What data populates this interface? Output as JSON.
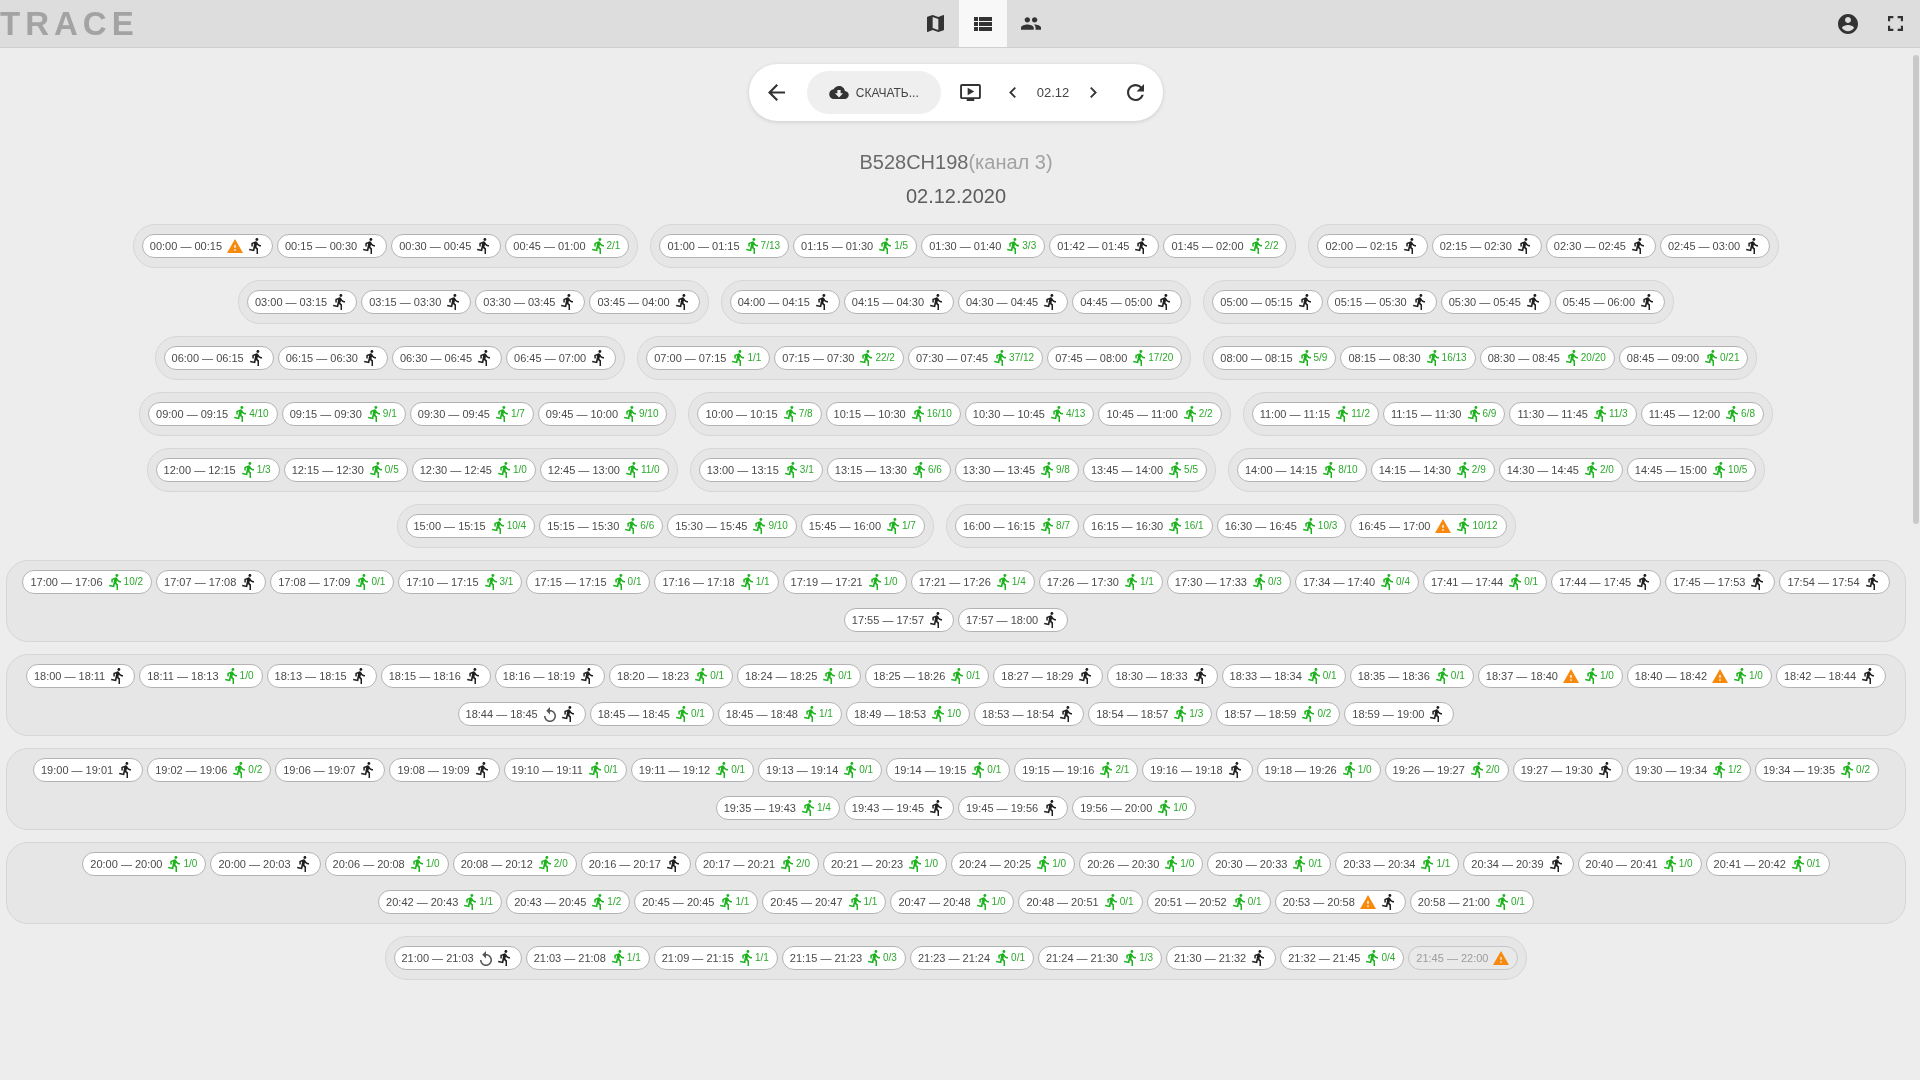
{
  "top_bar": {
    "logo": "TRACE",
    "nav_tabs": [
      {
        "selected": false
      },
      {
        "selected": true
      },
      {
        "selected": false
      }
    ]
  },
  "toolbar": {
    "download_label": "СКАЧАТЬ...",
    "date": "02.12"
  },
  "heading": {
    "camera": "B528CH198",
    "channel": "(канал 3)",
    "date": "02.12.2020"
  },
  "hour_groups": [
    {
      "lines": [
        {
          "chips": [
            {
              "time": "00:00 — 00:15",
              "kind": "idle",
              "alert": true,
              "replayed": false
            },
            {
              "time": "00:15 — 00:30",
              "kind": "idle",
              "alert": false,
              "replayed": false
            },
            {
              "time": "00:30 — 00:45",
              "kind": "idle",
              "alert": false,
              "replayed": false
            },
            {
              "time": "00:45 — 01:00",
              "kind": "counted",
              "count": "2/1",
              "alert": false,
              "replayed": false
            }
          ]
        }
      ]
    },
    {
      "lines": [
        {
          "chips": [
            {
              "time": "01:00 — 01:15",
              "kind": "counted",
              "count": "7/13",
              "alert": false,
              "replayed": false
            },
            {
              "time": "01:15 — 01:30",
              "kind": "counted",
              "count": "1/5",
              "alert": false,
              "replayed": false
            },
            {
              "time": "01:30 — 01:40",
              "kind": "counted",
              "count": "3/3",
              "alert": false,
              "replayed": false
            },
            {
              "time": "01:42 — 01:45",
              "kind": "idle",
              "alert": false,
              "replayed": false
            },
            {
              "time": "01:45 — 02:00",
              "kind": "counted",
              "count": "2/2",
              "alert": false,
              "replayed": false
            }
          ]
        }
      ]
    },
    {
      "lines": [
        {
          "chips": [
            {
              "time": "02:00 — 02:15",
              "kind": "idle",
              "alert": false,
              "replayed": false
            },
            {
              "time": "02:15 — 02:30",
              "kind": "idle",
              "alert": false,
              "replayed": false
            },
            {
              "time": "02:30 — 02:45",
              "kind": "idle",
              "alert": false,
              "replayed": false
            },
            {
              "time": "02:45 — 03:00",
              "kind": "idle",
              "alert": false,
              "replayed": false
            }
          ]
        }
      ]
    },
    {
      "lines": [
        {
          "chips": [
            {
              "time": "03:00 — 03:15",
              "kind": "idle",
              "alert": false,
              "replayed": false
            },
            {
              "time": "03:15 — 03:30",
              "kind": "idle",
              "alert": false,
              "replayed": false
            },
            {
              "time": "03:30 — 03:45",
              "kind": "idle",
              "alert": false,
              "replayed": false
            },
            {
              "time": "03:45 — 04:00",
              "kind": "idle",
              "alert": false,
              "replayed": false
            }
          ]
        }
      ]
    },
    {
      "lines": [
        {
          "chips": [
            {
              "time": "04:00 — 04:15",
              "kind": "idle",
              "alert": false,
              "replayed": false
            },
            {
              "time": "04:15 — 04:30",
              "kind": "idle",
              "alert": false,
              "replayed": false
            },
            {
              "time": "04:30 — 04:45",
              "kind": "idle",
              "alert": false,
              "replayed": false
            },
            {
              "time": "04:45 — 05:00",
              "kind": "idle",
              "alert": false,
              "replayed": false
            }
          ]
        }
      ]
    },
    {
      "lines": [
        {
          "chips": [
            {
              "time": "05:00 — 05:15",
              "kind": "idle",
              "alert": false,
              "replayed": false
            },
            {
              "time": "05:15 — 05:30",
              "kind": "idle",
              "alert": false,
              "replayed": false
            },
            {
              "time": "05:30 — 05:45",
              "kind": "idle",
              "alert": false,
              "replayed": false
            },
            {
              "time": "05:45 — 06:00",
              "kind": "idle",
              "alert": false,
              "replayed": false
            }
          ]
        }
      ]
    },
    {
      "lines": [
        {
          "chips": [
            {
              "time": "06:00 — 06:15",
              "kind": "idle",
              "alert": false,
              "replayed": false
            },
            {
              "time": "06:15 — 06:30",
              "kind": "idle",
              "alert": false,
              "replayed": false
            },
            {
              "time": "06:30 — 06:45",
              "kind": "idle",
              "alert": false,
              "replayed": false
            },
            {
              "time": "06:45 — 07:00",
              "kind": "idle",
              "alert": false,
              "replayed": false
            }
          ]
        }
      ]
    },
    {
      "lines": [
        {
          "chips": [
            {
              "time": "07:00 — 07:15",
              "kind": "counted",
              "count": "1/1",
              "alert": false,
              "replayed": false
            },
            {
              "time": "07:15 — 07:30",
              "kind": "counted",
              "count": "22/2",
              "alert": false,
              "replayed": false
            },
            {
              "time": "07:30 — 07:45",
              "kind": "counted",
              "count": "37/12",
              "alert": false,
              "replayed": false
            },
            {
              "time": "07:45 — 08:00",
              "kind": "counted",
              "count": "17/20",
              "alert": false,
              "replayed": false
            }
          ]
        }
      ]
    },
    {
      "lines": [
        {
          "chips": [
            {
              "time": "08:00 — 08:15",
              "kind": "counted",
              "count": "5/9",
              "alert": false,
              "replayed": false
            },
            {
              "time": "08:15 — 08:30",
              "kind": "counted",
              "count": "16/13",
              "alert": false,
              "replayed": false
            },
            {
              "time": "08:30 — 08:45",
              "kind": "counted",
              "count": "20/20",
              "alert": false,
              "replayed": false
            },
            {
              "time": "08:45 — 09:00",
              "kind": "counted",
              "count": "0/21",
              "alert": false,
              "replayed": false
            }
          ]
        }
      ]
    },
    {
      "lines": [
        {
          "chips": [
            {
              "time": "09:00 — 09:15",
              "kind": "counted",
              "count": "4/10",
              "alert": false,
              "replayed": false
            },
            {
              "time": "09:15 — 09:30",
              "kind": "counted",
              "count": "9/1",
              "alert": false,
              "replayed": false
            },
            {
              "time": "09:30 — 09:45",
              "kind": "counted",
              "count": "1/7",
              "alert": false,
              "replayed": false
            },
            {
              "time": "09:45 — 10:00",
              "kind": "counted",
              "count": "9/10",
              "alert": false,
              "replayed": false
            }
          ]
        }
      ]
    },
    {
      "lines": [
        {
          "chips": [
            {
              "time": "10:00 — 10:15",
              "kind": "counted",
              "count": "7/8",
              "alert": false,
              "replayed": false
            },
            {
              "time": "10:15 — 10:30",
              "kind": "counted",
              "count": "16/10",
              "alert": false,
              "replayed": false
            },
            {
              "time": "10:30 — 10:45",
              "kind": "counted",
              "count": "4/13",
              "alert": false,
              "replayed": false
            },
            {
              "time": "10:45 — 11:00",
              "kind": "counted",
              "count": "2/2",
              "alert": false,
              "replayed": false
            }
          ]
        }
      ]
    },
    {
      "lines": [
        {
          "chips": [
            {
              "time": "11:00 — 11:15",
              "kind": "counted",
              "count": "11/2",
              "alert": false,
              "replayed": false
            },
            {
              "time": "11:15 — 11:30",
              "kind": "counted",
              "count": "6/9",
              "alert": false,
              "replayed": false
            },
            {
              "time": "11:30 — 11:45",
              "kind": "counted",
              "count": "11/3",
              "alert": false,
              "replayed": false
            },
            {
              "time": "11:45 — 12:00",
              "kind": "counted",
              "count": "6/8",
              "alert": false,
              "replayed": false
            }
          ]
        }
      ]
    },
    {
      "lines": [
        {
          "chips": [
            {
              "time": "12:00 — 12:15",
              "kind": "counted",
              "count": "1/3",
              "alert": false,
              "replayed": false
            },
            {
              "time": "12:15 — 12:30",
              "kind": "counted",
              "count": "0/5",
              "alert": false,
              "replayed": false
            },
            {
              "time": "12:30 — 12:45",
              "kind": "counted",
              "count": "1/0",
              "alert": false,
              "replayed": false
            },
            {
              "time": "12:45 — 13:00",
              "kind": "counted",
              "count": "11/0",
              "alert": false,
              "replayed": false
            }
          ]
        }
      ]
    },
    {
      "lines": [
        {
          "chips": [
            {
              "time": "13:00 — 13:15",
              "kind": "counted",
              "count": "3/1",
              "alert": false,
              "replayed": false
            },
            {
              "time": "13:15 — 13:30",
              "kind": "counted",
              "count": "6/6",
              "alert": false,
              "replayed": false
            },
            {
              "time": "13:30 — 13:45",
              "kind": "counted",
              "count": "9/8",
              "alert": false,
              "replayed": false
            },
            {
              "time": "13:45 — 14:00",
              "kind": "counted",
              "count": "5/5",
              "alert": false,
              "replayed": false
            }
          ]
        }
      ]
    },
    {
      "lines": [
        {
          "chips": [
            {
              "time": "14:00 — 14:15",
              "kind": "counted",
              "count": "8/10",
              "alert": false,
              "replayed": false
            },
            {
              "time": "14:15 — 14:30",
              "kind": "counted",
              "count": "2/9",
              "alert": false,
              "replayed": false
            },
            {
              "time": "14:30 — 14:45",
              "kind": "counted",
              "count": "2/0",
              "alert": false,
              "replayed": false
            },
            {
              "time": "14:45 — 15:00",
              "kind": "counted",
              "count": "10/5",
              "alert": false,
              "replayed": false
            }
          ]
        }
      ]
    },
    {
      "lines": [
        {
          "chips": [
            {
              "time": "15:00 — 15:15",
              "kind": "counted",
              "count": "10/4",
              "alert": false,
              "replayed": false
            },
            {
              "time": "15:15 — 15:30",
              "kind": "counted",
              "count": "6/6",
              "alert": false,
              "replayed": false
            },
            {
              "time": "15:30 — 15:45",
              "kind": "counted",
              "count": "9/10",
              "alert": false,
              "replayed": false
            },
            {
              "time": "15:45 — 16:00",
              "kind": "counted",
              "count": "1/7",
              "alert": false,
              "replayed": false
            }
          ]
        }
      ]
    },
    {
      "lines": [
        {
          "chips": [
            {
              "time": "16:00 — 16:15",
              "kind": "counted",
              "count": "8/7",
              "alert": false,
              "replayed": false
            },
            {
              "time": "16:15 — 16:30",
              "kind": "counted",
              "count": "16/1",
              "alert": false,
              "replayed": false
            },
            {
              "time": "16:30 — 16:45",
              "kind": "counted",
              "count": "10/3",
              "alert": false,
              "replayed": false
            },
            {
              "time": "16:45 — 17:00",
              "kind": "counted",
              "count": "10/12",
              "alert": true,
              "replayed": false
            }
          ]
        }
      ]
    },
    {
      "lines": [
        {
          "chips": [
            {
              "time": "17:00 — 17:06",
              "kind": "counted",
              "count": "10/2",
              "alert": false,
              "replayed": false
            },
            {
              "time": "17:07 — 17:08",
              "kind": "idle",
              "alert": false,
              "replayed": false
            },
            {
              "time": "17:08 — 17:09",
              "kind": "counted",
              "count": "0/1",
              "alert": false,
              "replayed": false
            },
            {
              "time": "17:10 — 17:15",
              "kind": "counted",
              "count": "3/1",
              "alert": false,
              "replayed": false
            },
            {
              "time": "17:15 — 17:15",
              "kind": "counted",
              "count": "0/1",
              "alert": false,
              "replayed": false
            },
            {
              "time": "17:16 — 17:18",
              "kind": "counted",
              "count": "1/1",
              "alert": false,
              "replayed": false
            },
            {
              "time": "17:19 — 17:21",
              "kind": "counted",
              "count": "1/0",
              "alert": false,
              "replayed": false
            },
            {
              "time": "17:21 — 17:26",
              "kind": "counted",
              "count": "1/4",
              "alert": false,
              "replayed": false
            },
            {
              "time": "17:26 — 17:30",
              "kind": "counted",
              "count": "1/1",
              "alert": false,
              "replayed": false
            },
            {
              "time": "17:30 — 17:33",
              "kind": "counted",
              "count": "0/3",
              "alert": false,
              "replayed": false
            },
            {
              "time": "17:34 — 17:40",
              "kind": "counted",
              "count": "0/4",
              "alert": false,
              "replayed": false
            },
            {
              "time": "17:41 — 17:44",
              "kind": "counted",
              "count": "0/1",
              "alert": false,
              "replayed": false
            },
            {
              "time": "17:44 — 17:45",
              "kind": "idle",
              "alert": false,
              "replayed": false
            },
            {
              "time": "17:45 — 17:53",
              "kind": "idle",
              "alert": false,
              "replayed": false
            },
            {
              "time": "17:54 — 17:54",
              "kind": "idle",
              "alert": false,
              "replayed": false
            }
          ]
        },
        {
          "chips": [
            {
              "time": "17:55 — 17:57",
              "kind": "idle",
              "alert": false,
              "replayed": false
            },
            {
              "time": "17:57 — 18:00",
              "kind": "idle",
              "alert": false,
              "replayed": false
            }
          ]
        }
      ]
    },
    {
      "lines": [
        {
          "chips": [
            {
              "time": "18:00 — 18:11",
              "kind": "idle",
              "alert": false,
              "replayed": false
            },
            {
              "time": "18:11 — 18:13",
              "kind": "counted",
              "count": "1/0",
              "alert": false,
              "replayed": false
            },
            {
              "time": "18:13 — 18:15",
              "kind": "idle",
              "alert": false,
              "replayed": false
            },
            {
              "time": "18:15 — 18:16",
              "kind": "idle",
              "alert": false,
              "replayed": false
            },
            {
              "time": "18:16 — 18:19",
              "kind": "idle",
              "alert": false,
              "replayed": false
            },
            {
              "time": "18:20 — 18:23",
              "kind": "counted",
              "count": "0/1",
              "alert": false,
              "replayed": false
            },
            {
              "time": "18:24 — 18:25",
              "kind": "counted",
              "count": "0/1",
              "alert": false,
              "replayed": false
            },
            {
              "time": "18:25 — 18:26",
              "kind": "counted",
              "count": "0/1",
              "alert": false,
              "replayed": false
            },
            {
              "time": "18:27 — 18:29",
              "kind": "idle",
              "alert": false,
              "replayed": false
            },
            {
              "time": "18:30 — 18:33",
              "kind": "idle",
              "alert": false,
              "replayed": false
            },
            {
              "time": "18:33 — 18:34",
              "kind": "counted",
              "count": "0/1",
              "alert": false,
              "replayed": false
            },
            {
              "time": "18:35 — 18:36",
              "kind": "counted",
              "count": "0/1",
              "alert": false,
              "replayed": false
            },
            {
              "time": "18:37 — 18:40",
              "kind": "counted",
              "count": "1/0",
              "alert": true,
              "replayed": false
            },
            {
              "time": "18:40 — 18:42",
              "kind": "counted",
              "count": "1/0",
              "alert": true,
              "replayed": false
            },
            {
              "time": "18:42 — 18:44",
              "kind": "idle",
              "alert": false,
              "replayed": false
            }
          ]
        },
        {
          "chips": [
            {
              "time": "18:44 — 18:45",
              "kind": "idle",
              "alert": false,
              "replayed": true
            },
            {
              "time": "18:45 — 18:45",
              "kind": "counted",
              "count": "0/1",
              "alert": false,
              "replayed": false
            },
            {
              "time": "18:45 — 18:48",
              "kind": "counted",
              "count": "1/1",
              "alert": false,
              "replayed": false
            },
            {
              "time": "18:49 — 18:53",
              "kind": "counted",
              "count": "1/0",
              "alert": false,
              "replayed": false
            },
            {
              "time": "18:53 — 18:54",
              "kind": "idle",
              "alert": false,
              "replayed": false
            },
            {
              "time": "18:54 — 18:57",
              "kind": "counted",
              "count": "1/3",
              "alert": false,
              "replayed": false
            },
            {
              "time": "18:57 — 18:59",
              "kind": "counted",
              "count": "0/2",
              "alert": false,
              "replayed": false
            },
            {
              "time": "18:59 — 19:00",
              "kind": "idle",
              "alert": false,
              "replayed": false
            }
          ]
        }
      ]
    },
    {
      "lines": [
        {
          "chips": [
            {
              "time": "19:00 — 19:01",
              "kind": "idle",
              "alert": false,
              "replayed": false
            },
            {
              "time": "19:02 — 19:06",
              "kind": "counted",
              "count": "0/2",
              "alert": false,
              "replayed": false
            },
            {
              "time": "19:06 — 19:07",
              "kind": "idle",
              "alert": false,
              "replayed": false
            },
            {
              "time": "19:08 — 19:09",
              "kind": "idle",
              "alert": false,
              "replayed": false
            },
            {
              "time": "19:10 — 19:11",
              "kind": "counted",
              "count": "0/1",
              "alert": false,
              "replayed": false
            },
            {
              "time": "19:11 — 19:12",
              "kind": "counted",
              "count": "0/1",
              "alert": false,
              "replayed": false
            },
            {
              "time": "19:13 — 19:14",
              "kind": "counted",
              "count": "0/1",
              "alert": false,
              "replayed": false
            },
            {
              "time": "19:14 — 19:15",
              "kind": "counted",
              "count": "0/1",
              "alert": false,
              "replayed": false
            },
            {
              "time": "19:15 — 19:16",
              "kind": "counted",
              "count": "2/1",
              "alert": false,
              "replayed": false
            },
            {
              "time": "19:16 — 19:18",
              "kind": "idle",
              "alert": false,
              "replayed": false
            },
            {
              "time": "19:18 — 19:26",
              "kind": "counted",
              "count": "1/0",
              "alert": false,
              "replayed": false
            },
            {
              "time": "19:26 — 19:27",
              "kind": "counted",
              "count": "2/0",
              "alert": false,
              "replayed": false
            },
            {
              "time": "19:27 — 19:30",
              "kind": "idle",
              "alert": false,
              "replayed": false
            },
            {
              "time": "19:30 — 19:34",
              "kind": "counted",
              "count": "1/2",
              "alert": false,
              "replayed": false
            },
            {
              "time": "19:34 — 19:35",
              "kind": "counted",
              "count": "0/2",
              "alert": false,
              "replayed": false
            }
          ]
        },
        {
          "chips": [
            {
              "time": "19:35 — 19:43",
              "kind": "counted",
              "count": "1/4",
              "alert": false,
              "replayed": false
            },
            {
              "time": "19:43 — 19:45",
              "kind": "idle",
              "alert": false,
              "replayed": false
            },
            {
              "time": "19:45 — 19:56",
              "kind": "idle",
              "alert": false,
              "replayed": false
            },
            {
              "time": "19:56 — 20:00",
              "kind": "counted",
              "count": "1/0",
              "alert": false,
              "replayed": false
            }
          ]
        }
      ]
    },
    {
      "lines": [
        {
          "chips": [
            {
              "time": "20:00 — 20:00",
              "kind": "counted",
              "count": "1/0",
              "alert": false,
              "replayed": false
            },
            {
              "time": "20:00 — 20:03",
              "kind": "idle",
              "alert": false,
              "replayed": false
            },
            {
              "time": "20:06 — 20:08",
              "kind": "counted",
              "count": "1/0",
              "alert": false,
              "replayed": false
            },
            {
              "time": "20:08 — 20:12",
              "kind": "counted",
              "count": "2/0",
              "alert": false,
              "replayed": false
            },
            {
              "time": "20:16 — 20:17",
              "kind": "idle",
              "alert": false,
              "replayed": false
            },
            {
              "time": "20:17 — 20:21",
              "kind": "counted",
              "count": "2/0",
              "alert": false,
              "replayed": false
            },
            {
              "time": "20:21 — 20:23",
              "kind": "counted",
              "count": "1/0",
              "alert": false,
              "replayed": false
            },
            {
              "time": "20:24 — 20:25",
              "kind": "counted",
              "count": "1/0",
              "alert": false,
              "replayed": false
            },
            {
              "time": "20:26 — 20:30",
              "kind": "counted",
              "count": "1/0",
              "alert": false,
              "replayed": false
            },
            {
              "time": "20:30 — 20:33",
              "kind": "counted",
              "count": "0/1",
              "alert": false,
              "replayed": false
            },
            {
              "time": "20:33 — 20:34",
              "kind": "counted",
              "count": "1/1",
              "alert": false,
              "replayed": false
            },
            {
              "time": "20:34 — 20:39",
              "kind": "idle",
              "alert": false,
              "replayed": false
            },
            {
              "time": "20:40 — 20:41",
              "kind": "counted",
              "count": "1/0",
              "alert": false,
              "replayed": false
            },
            {
              "time": "20:41 — 20:42",
              "kind": "counted",
              "count": "0/1",
              "alert": false,
              "replayed": false
            }
          ]
        },
        {
          "chips": [
            {
              "time": "20:42 — 20:43",
              "kind": "counted",
              "count": "1/1",
              "alert": false,
              "replayed": false
            },
            {
              "time": "20:43 — 20:45",
              "kind": "counted",
              "count": "1/2",
              "alert": false,
              "replayed": false
            },
            {
              "time": "20:45 — 20:45",
              "kind": "counted",
              "count": "1/1",
              "alert": false,
              "replayed": false
            },
            {
              "time": "20:45 — 20:47",
              "kind": "counted",
              "count": "1/1",
              "alert": false,
              "replayed": false
            },
            {
              "time": "20:47 — 20:48",
              "kind": "counted",
              "count": "1/0",
              "alert": false,
              "replayed": false
            },
            {
              "time": "20:48 — 20:51",
              "kind": "counted",
              "count": "0/1",
              "alert": false,
              "replayed": false
            },
            {
              "time": "20:51 — 20:52",
              "kind": "counted",
              "count": "0/1",
              "alert": false,
              "replayed": false
            },
            {
              "time": "20:53 — 20:58",
              "kind": "idle",
              "alert": true,
              "replayed": false
            },
            {
              "time": "20:58 — 21:00",
              "kind": "counted",
              "count": "0/1",
              "alert": false,
              "replayed": false
            }
          ]
        }
      ]
    },
    {
      "lines": [
        {
          "chips": [
            {
              "time": "21:00 — 21:03",
              "kind": "idle",
              "alert": false,
              "replayed": true
            },
            {
              "time": "21:03 — 21:08",
              "kind": "counted",
              "count": "1/1",
              "alert": false,
              "replayed": false
            },
            {
              "time": "21:09 — 21:15",
              "kind": "counted",
              "count": "1/1",
              "alert": false,
              "replayed": false
            },
            {
              "time": "21:15 — 21:23",
              "kind": "counted",
              "count": "0/3",
              "alert": false,
              "replayed": false
            },
            {
              "time": "21:23 — 21:24",
              "kind": "counted",
              "count": "0/1",
              "alert": false,
              "replayed": false
            },
            {
              "time": "21:24 — 21:30",
              "kind": "counted",
              "count": "1/3",
              "alert": false,
              "replayed": false
            },
            {
              "time": "21:30 — 21:32",
              "kind": "idle",
              "alert": false,
              "replayed": false
            },
            {
              "time": "21:32 — 21:45",
              "kind": "counted",
              "count": "0/4",
              "alert": false,
              "replayed": false
            },
            {
              "time": "21:45 — 22:00",
              "kind": "pending",
              "alert": true,
              "replayed": false
            }
          ]
        }
      ]
    }
  ]
}
